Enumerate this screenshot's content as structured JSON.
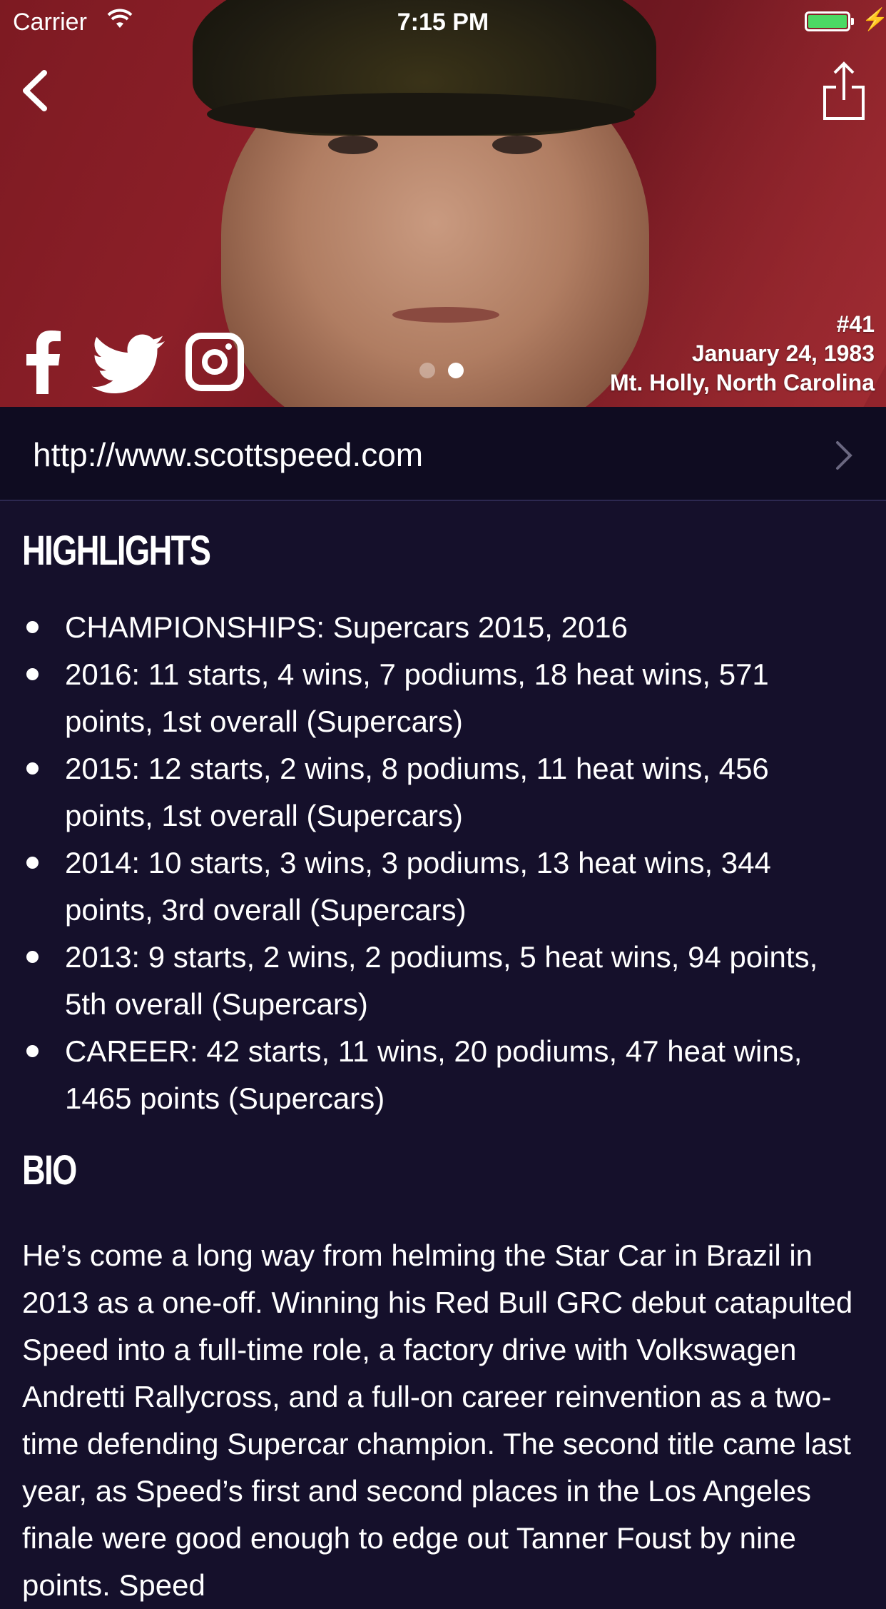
{
  "status_bar": {
    "carrier": "Carrier",
    "time": "7:15 PM"
  },
  "colors": {
    "background": "#15102b",
    "website_row_bg": "#0f0c21",
    "hero_red": "#8c1f28",
    "battery_green": "#4cd964"
  },
  "icons": [
    "wifi-icon",
    "battery-icon",
    "back-chevron-icon",
    "share-icon",
    "facebook-icon",
    "twitter-icon",
    "instagram-icon",
    "chevron-right-icon"
  ],
  "driver": {
    "number": "#41",
    "birth_date": "January 24, 1983",
    "hometown": "Mt. Holly, North Carolina",
    "website": "http://www.scottspeed.com"
  },
  "carousel": {
    "page_count": 2,
    "current_page": 2
  },
  "highlights": {
    "title": "HIGHLIGHTS",
    "items": [
      "CHAMPIONSHIPS: Supercars 2015, 2016",
      "2016: 11 starts, 4 wins, 7 podiums, 18 heat wins, 571 points, 1st overall (Supercars)",
      "2015: 12 starts, 2 wins, 8 podiums, 11 heat wins, 456 points, 1st overall (Supercars)",
      "2014: 10 starts, 3 wins, 3 podiums, 13 heat wins, 344 points, 3rd overall (Supercars)",
      "2013: 9 starts, 2 wins, 2 podiums, 5 heat wins, 94 points, 5th overall (Supercars)",
      "CAREER: 42 starts, 11 wins, 20 podiums, 47 heat wins, 1465 points (Supercars)"
    ]
  },
  "bio": {
    "title": "BIO",
    "text": "He’s come a long way from helming the Star Car in Brazil in 2013 as a one-off. Winning his Red Bull GRC debut catapulted Speed into a full-time role, a factory drive with Volkswagen Andretti Rallycross, and a full-on career reinvention as a two-time defending Supercar champion. The second title came last year, as Speed’s first and second places in the Los Angeles finale were good enough to edge out Tanner Foust by nine points. Speed"
  }
}
